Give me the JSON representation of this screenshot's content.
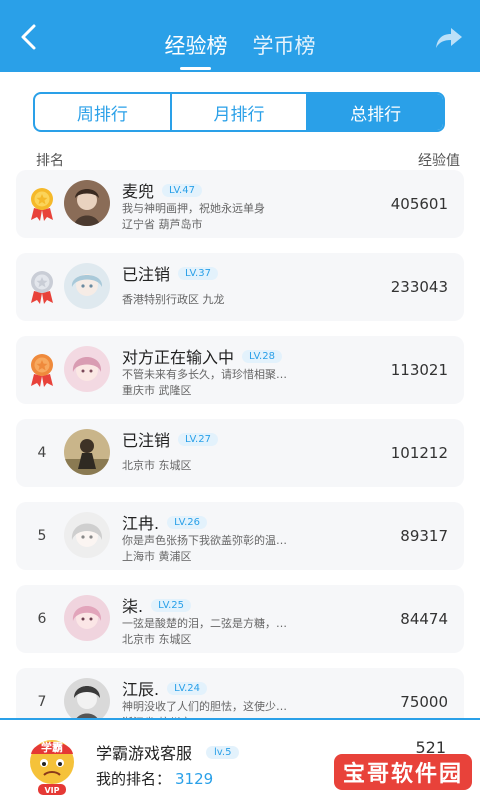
{
  "header": {
    "tabs": [
      {
        "label": "经验榜",
        "active": true
      },
      {
        "label": "学币榜",
        "active": false
      }
    ],
    "icons": {
      "back": "back-arrow-icon",
      "share": "share-icon"
    },
    "color": "#2aa0e8"
  },
  "segments": [
    {
      "label": "周排行",
      "active": false
    },
    {
      "label": "月排行",
      "active": false
    },
    {
      "label": "总排行",
      "active": true
    }
  ],
  "columns": {
    "rank": "排名",
    "value": "经验值"
  },
  "rows": [
    {
      "rank": "1",
      "medal": "gold",
      "name": "麦兜",
      "level": "LV.47",
      "signature": "我与神明画押，祝她永远单身",
      "location": "辽宁省 葫芦岛市",
      "score": "405601"
    },
    {
      "rank": "2",
      "medal": "silver",
      "name": "已注销",
      "level": "LV.37",
      "signature": "",
      "location": "香港特别行政区 九龙",
      "score": "233043"
    },
    {
      "rank": "3",
      "medal": "bronze",
      "name": "对方正在输入中",
      "level": "LV.28",
      "signature": "不管未来有多长久，请珍惜相聚的每一刻；不管...",
      "location": "重庆市 武隆区",
      "score": "113021"
    },
    {
      "rank": "4",
      "medal": "",
      "name": "已注销",
      "level": "LV.27",
      "signature": "",
      "location": "北京市 东城区",
      "score": "101212"
    },
    {
      "rank": "5",
      "medal": "",
      "name": "江冉.",
      "level": "LV.26",
      "signature": "你是声色张扬下我欲盖弥彰的温柔理想.",
      "location": "上海市 黄浦区",
      "score": "89317"
    },
    {
      "rank": "6",
      "medal": "",
      "name": "柒.",
      "level": "LV.25",
      "signature": "一弦是酸楚的泪，二弦是方糖，三弦点燃篝火，四...",
      "location": "北京市 东城区",
      "score": "84474"
    },
    {
      "rank": "7",
      "medal": "",
      "name": "江辰.",
      "level": "LV.24",
      "signature": "神明没收了人们的胆怯，这使少年们的青春轰轰烈...",
      "location": "浙江省 杭州市",
      "score": "75000"
    }
  ],
  "me": {
    "name": "学霸游戏客服",
    "level": "lv.5",
    "rank_label": "我的排名：",
    "rank_value": "3129",
    "score": "521",
    "avatar_badge": "VIP",
    "avatar_text": "学霸"
  },
  "watermark": "宝哥软件园"
}
